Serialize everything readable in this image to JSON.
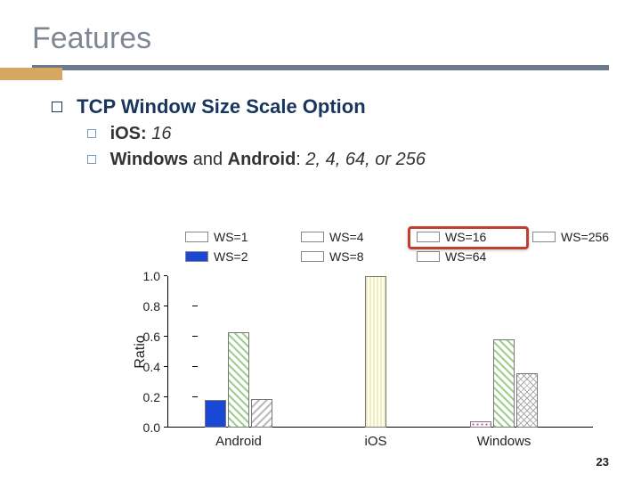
{
  "title": "Features",
  "heading": "TCP Window Size Scale Option",
  "sub1": {
    "label": "iOS:",
    "value": "16"
  },
  "sub2": {
    "pre": "Windows",
    "mid": " and ",
    "post": "Android",
    "suffix_label": ": ",
    "suffix_value": "2, 4, 64, or 256"
  },
  "legend": {
    "ws1": "WS=1",
    "ws2": "WS=2",
    "ws4": "WS=4",
    "ws8": "WS=8",
    "ws16": "WS=16",
    "ws64": "WS=64",
    "ws256": "WS=256"
  },
  "axis": {
    "ylabel": "Ratio",
    "ticks": [
      "0.0",
      "0.2",
      "0.4",
      "0.6",
      "0.8",
      "1.0"
    ]
  },
  "cats": {
    "android": "Android",
    "ios": "iOS",
    "windows": "Windows"
  },
  "page": "23",
  "chart_data": {
    "type": "bar",
    "title": "TCP Window Size Scale Option — Ratio by OS",
    "xlabel": "",
    "ylabel": "Ratio",
    "ylim": [
      0.0,
      1.0
    ],
    "categories": [
      "Android",
      "iOS",
      "Windows"
    ],
    "series": [
      {
        "name": "WS=1",
        "values": [
          null,
          null,
          null
        ]
      },
      {
        "name": "WS=2",
        "values": [
          0.18,
          null,
          null
        ]
      },
      {
        "name": "WS=4",
        "values": [
          0.63,
          null,
          0.04
        ]
      },
      {
        "name": "WS=8",
        "values": [
          0.19,
          null,
          null
        ]
      },
      {
        "name": "WS=16",
        "values": [
          null,
          1.0,
          null
        ]
      },
      {
        "name": "WS=64",
        "values": [
          null,
          null,
          0.58
        ]
      },
      {
        "name": "WS=256",
        "values": [
          null,
          null,
          0.36
        ]
      }
    ],
    "highlight_series": "WS=16",
    "legend_position": "top"
  }
}
